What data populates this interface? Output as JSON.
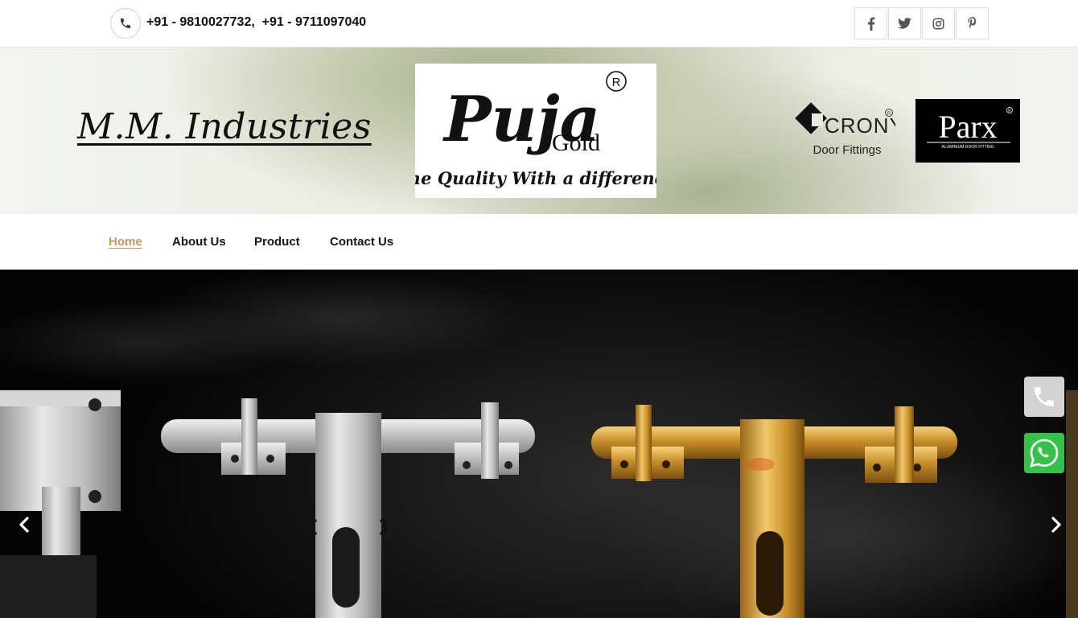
{
  "topbar": {
    "phone_numbers": "+91 - 9810027732,  +91 - 9711097040",
    "social": [
      "facebook-icon",
      "twitter-icon",
      "instagram-icon",
      "pinterest-icon"
    ]
  },
  "header": {
    "company_name": "M.M. Industries",
    "logos": {
      "puja": {
        "brand": "Puja",
        "sub": "Gold",
        "mark": "R",
        "tagline": "The Quality With a difference"
      },
      "crony": {
        "brand": "CRONY",
        "mark": "R",
        "sub": "Door Fittings"
      },
      "parx": {
        "brand": "Parx",
        "mark": "R",
        "sub": "ALUMINIUM DOOR FITTING"
      }
    }
  },
  "nav": {
    "items": [
      {
        "label": "Home",
        "active": true
      },
      {
        "label": "About Us",
        "active": false
      },
      {
        "label": "Product",
        "active": false
      },
      {
        "label": "Contact Us",
        "active": false
      }
    ]
  },
  "slider": {
    "prev_icon": "chevron-left-icon",
    "next_icon": "chevron-right-icon"
  },
  "floating": {
    "call_icon": "phone-icon",
    "whatsapp_icon": "whatsapp-icon"
  },
  "colors": {
    "accent": "#c8955a",
    "whatsapp": "#35c24a"
  }
}
